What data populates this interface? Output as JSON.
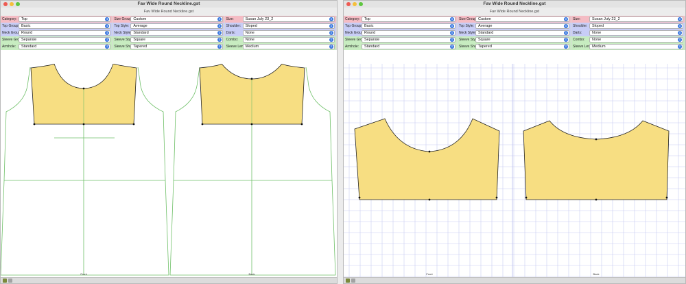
{
  "left_window": {
    "title": "Fav Wide Round Neckline.gst",
    "subtitle": "Fav Wide Round Neckline.gst",
    "rows": [
      {
        "color": "pink",
        "cells": [
          {
            "label": "Category:",
            "value": "Top"
          },
          {
            "label": "Size Group:",
            "value": "Custom"
          },
          {
            "label": "Size:",
            "value": "Susan July 23_2"
          }
        ]
      },
      {
        "color": "violet",
        "cells": [
          {
            "label": "Top Group:",
            "value": "Basic"
          },
          {
            "label": "Top Style:",
            "value": "Average"
          },
          {
            "label": "Shoulder:",
            "value": "Sloped"
          }
        ]
      },
      {
        "color": "violet",
        "cells": [
          {
            "label": "Neck Group:",
            "value": "Round"
          },
          {
            "label": "Neck Style:",
            "value": "Standard"
          },
          {
            "label": "Darts:",
            "value": "None"
          }
        ]
      },
      {
        "color": "green",
        "cells": [
          {
            "label": "Sleeve Group:",
            "value": "Separate"
          },
          {
            "label": "Sleeve Style:",
            "value": "Square"
          },
          {
            "label": "Combo:",
            "value": "None"
          }
        ]
      },
      {
        "color": "green",
        "cells": [
          {
            "label": "Armhole:",
            "value": "Standard"
          },
          {
            "label": "Sleeve Shape:",
            "value": "Tapered"
          },
          {
            "label": "Sleeve Length:",
            "value": "Medium"
          }
        ]
      }
    ],
    "view_labels": {
      "front": "Front",
      "back": "Back"
    }
  },
  "right_window": {
    "title": "Fav Wide Round Neckline.gst",
    "subtitle": "Fav Wide Round Neckline.gst",
    "rows": [
      {
        "color": "pink",
        "cells": [
          {
            "label": "Category:",
            "value": "Top"
          },
          {
            "label": "Size Group:",
            "value": "Custom"
          },
          {
            "label": "Size:",
            "value": "Susan July 23_2"
          }
        ]
      },
      {
        "color": "violet",
        "cells": [
          {
            "label": "Top Group:",
            "value": "Basic"
          },
          {
            "label": "Top Style:",
            "value": "Average"
          },
          {
            "label": "Shoulder:",
            "value": "Sloped"
          }
        ]
      },
      {
        "color": "violet",
        "cells": [
          {
            "label": "Neck Group:",
            "value": "Round"
          },
          {
            "label": "Neck Style:",
            "value": "Standard"
          },
          {
            "label": "Darts:",
            "value": "None"
          }
        ]
      },
      {
        "color": "green",
        "cells": [
          {
            "label": "Sleeve Group:",
            "value": "Separate"
          },
          {
            "label": "Sleeve Style:",
            "value": "Square"
          },
          {
            "label": "Combo:",
            "value": "None"
          }
        ]
      },
      {
        "color": "green",
        "cells": [
          {
            "label": "Armhole:",
            "value": "Standard"
          },
          {
            "label": "Sleeve Shape:",
            "value": "Tapered"
          },
          {
            "label": "Sleeve Length:",
            "value": "Medium"
          }
        ]
      }
    ],
    "view_labels": {
      "front": "Front",
      "back": "Back"
    }
  },
  "colors": {
    "yoke_fill": "#f7de82",
    "outline": "#6dbf66",
    "grid": "#c8ccf2"
  },
  "icons": [
    "chevron-updown-icon",
    "close-light",
    "minimize-light",
    "maximize-light"
  ]
}
